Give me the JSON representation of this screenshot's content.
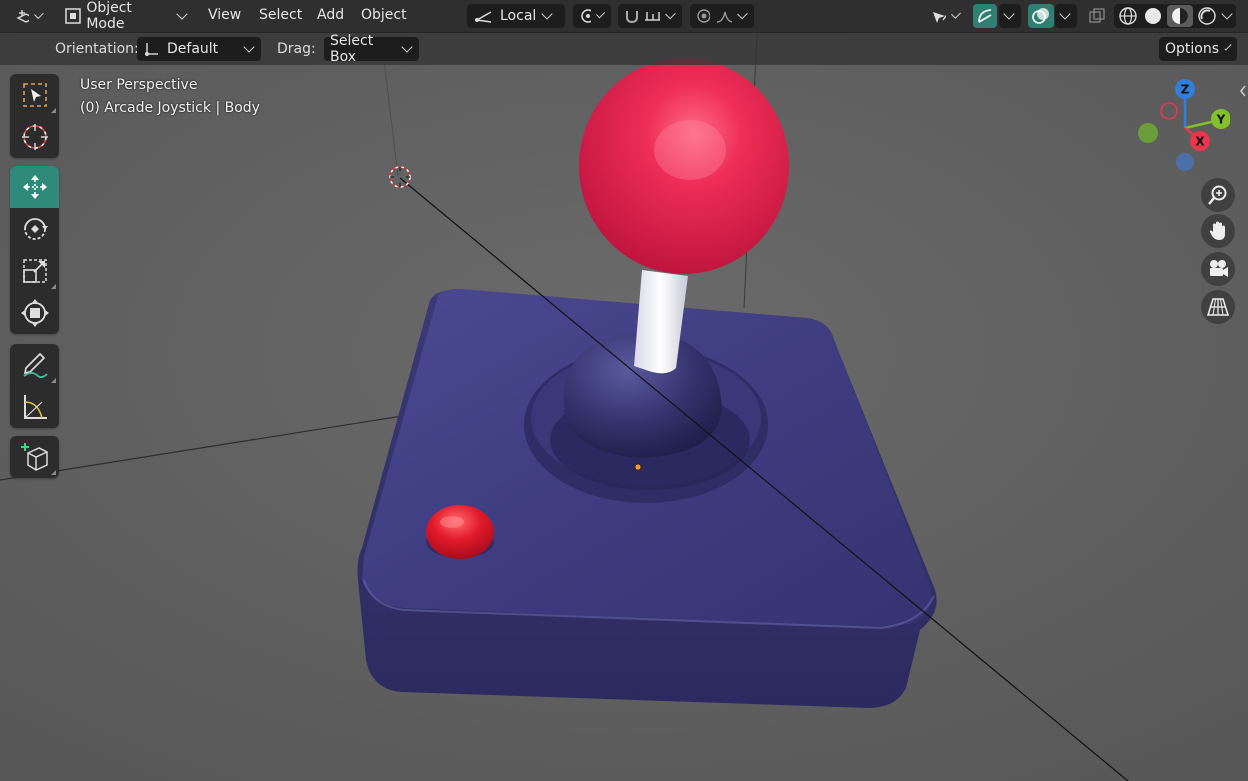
{
  "header": {
    "mode_label": "Object Mode",
    "menus": [
      "View",
      "Select",
      "Add",
      "Object"
    ],
    "transform_orientation": "Local"
  },
  "subheader": {
    "orientation_label": "Orientation:",
    "orientation_value": "Default",
    "drag_label": "Drag:",
    "drag_value": "Select Box",
    "options_label": "Options"
  },
  "viewport": {
    "perspective_label": "User Perspective",
    "object_label": "(0) Arcade Joystick | Body"
  },
  "gizmo": {
    "axes": [
      {
        "label": "Z",
        "color": "#2f7fdc"
      },
      {
        "label": "Y",
        "color": "#82c12a"
      },
      {
        "label": "X",
        "color": "#e8364d"
      }
    ]
  },
  "toolbar": {
    "tools": [
      "select-box",
      "cursor",
      "move",
      "rotate",
      "scale",
      "transform",
      "annotate",
      "measure",
      "add-cube"
    ],
    "active_tool": "move"
  },
  "colors": {
    "accent": "#2f8a7a",
    "joystick_base": "#3c3a78",
    "joystick_ball": "#e0234b"
  }
}
